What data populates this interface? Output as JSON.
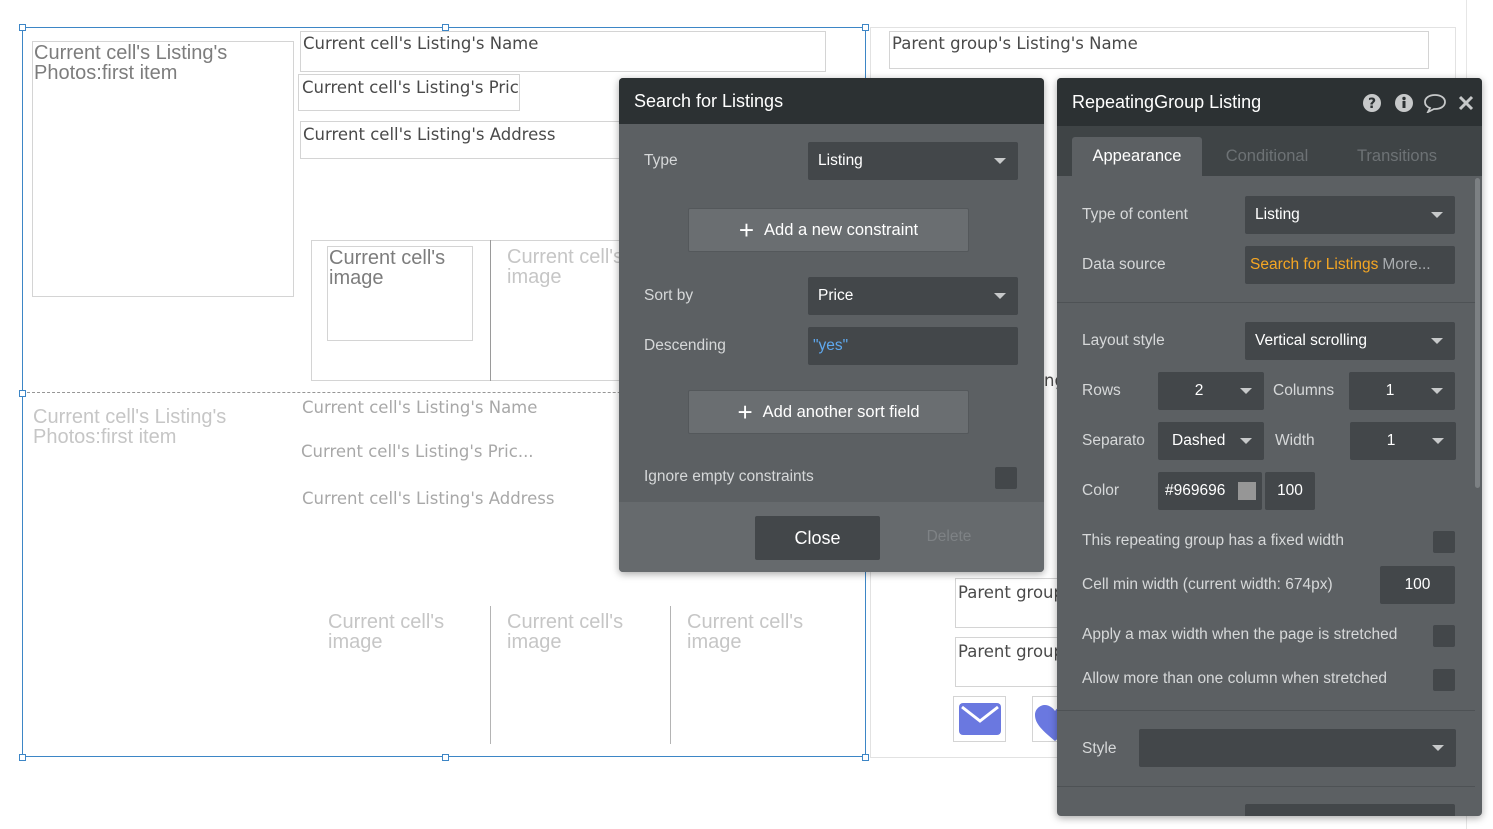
{
  "canvas": {
    "cell1": {
      "photo": "Current cell's Listing's Photos:first item",
      "name": "Current cell's Listing's Name",
      "price": "Current cell's Listing's Pric...",
      "address": "Current cell's Listing's Address",
      "images": [
        "Current cell's image",
        "Current cell's image"
      ]
    },
    "cell2": {
      "photo": "Current cell's Listing's Photos:first item",
      "name": "Current cell's Listing's Name",
      "price": "Current cell's Listing's Pric...",
      "address": "Current cell's Listing's Address",
      "images": [
        "Current cell's image",
        "Current cell's image",
        "Current cell's image"
      ]
    },
    "right": {
      "name": "Parent group's Listing's Name",
      "partial_text": "ng",
      "field1": "Parent group",
      "field2": "Parent group",
      "icons": [
        "envelope-icon",
        "heart-icon"
      ],
      "icon_color": "#6a78e0"
    }
  },
  "search_panel": {
    "title": "Search for Listings",
    "type_label": "Type",
    "type_value": "Listing",
    "add_constraint": "Add a new constraint",
    "sort_label": "Sort by",
    "sort_value": "Price",
    "desc_label": "Descending",
    "desc_value": "\"yes\"",
    "add_sort": "Add another sort field",
    "ignore_label": "Ignore empty constraints",
    "close": "Close",
    "delete": "Delete"
  },
  "rg_panel": {
    "title": "RepeatingGroup Listing",
    "header_icons": [
      "help-icon",
      "info-icon",
      "comment-icon",
      "close-icon"
    ],
    "tabs": [
      "Appearance",
      "Conditional",
      "Transitions"
    ],
    "type_label": "Type of content",
    "type_value": "Listing",
    "source_label": "Data source",
    "source_value": "Search for Listings",
    "source_more": "More...",
    "layout_label": "Layout style",
    "layout_value": "Vertical scrolling",
    "rows_label": "Rows",
    "rows_value": "2",
    "columns_label": "Columns",
    "columns_value": "1",
    "separator_label": "Separato",
    "separator_value": "Dashed",
    "width_label": "Width",
    "width_value": "1",
    "color_label": "Color",
    "color_value": "#969696",
    "color_swatch": "#969696",
    "opacity_value": "100",
    "fixed_width_label": "This repeating group has a fixed width",
    "min_width_label": "Cell min width (current width: 674px)",
    "min_width_value": "100",
    "max_width_label": "Apply a max width when the page is stretched",
    "more_cols_label": "Allow more than one column when stretched",
    "style_label": "Style",
    "style_value": ""
  },
  "colors": {
    "panel_bg": "#5c6063",
    "panel_header": "#2c3133",
    "accent_orange": "#f5a623",
    "link_blue": "#5fa9ef",
    "selection_blue": "#3d86c6"
  }
}
